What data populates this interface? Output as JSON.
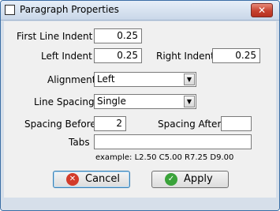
{
  "window": {
    "title": "Paragraph Properties",
    "close_glyph": "✕"
  },
  "form": {
    "first_line_indent": {
      "label": "First Line Indent",
      "value": "0.25"
    },
    "left_indent": {
      "label": "Left Indent",
      "value": "0.25"
    },
    "right_indent": {
      "label": "Right Indent",
      "value": "0.25"
    },
    "alignment": {
      "label": "Alignment",
      "value": "Left"
    },
    "line_spacing": {
      "label": "Line Spacing",
      "value": "Single"
    },
    "spacing_before": {
      "label": "Spacing Before",
      "value": "2"
    },
    "spacing_after": {
      "label": "Spacing After",
      "value": ""
    },
    "tabs": {
      "label": "Tabs",
      "value": "",
      "example": "example: L2.50 C5.00 R7.25 D9.00"
    }
  },
  "buttons": {
    "cancel": {
      "label": "Cancel",
      "icon": "cancel-icon",
      "icon_color": "#d23b2a"
    },
    "apply": {
      "label": "Apply",
      "icon": "checkmark-icon",
      "icon_color": "#3aa33a"
    }
  },
  "icons": {
    "dropdown_arrow": "▼",
    "check": "✓",
    "cross": "✕"
  }
}
